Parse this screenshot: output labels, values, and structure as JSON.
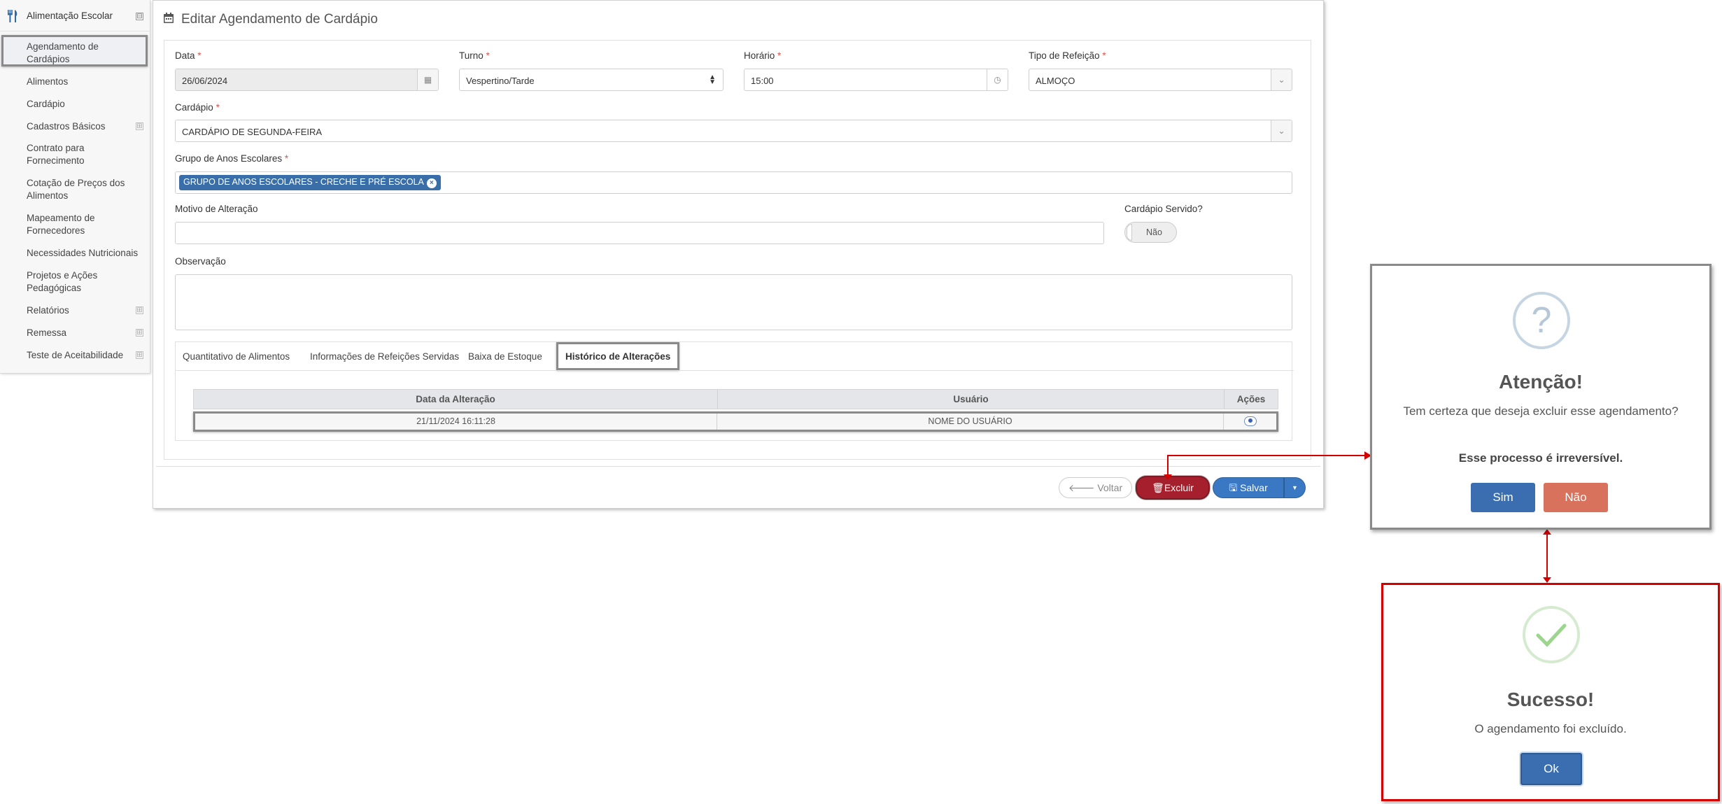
{
  "sidebar": {
    "title": "Alimentação Escolar",
    "toggle": "⊟",
    "items": [
      {
        "label": "Agendamento de Cardápios",
        "expandable": false
      },
      {
        "label": "Alimentos",
        "expandable": false
      },
      {
        "label": "Cardápio",
        "expandable": false
      },
      {
        "label": "Cadastros Básicos",
        "expandable": true
      },
      {
        "label": "Contrato para Fornecimento",
        "expandable": false
      },
      {
        "label": "Cotação de Preços dos Alimentos",
        "expandable": false
      },
      {
        "label": "Mapeamento de Fornecedores",
        "expandable": false
      },
      {
        "label": "Necessidades Nutricionais",
        "expandable": false
      },
      {
        "label": "Projetos e Ações Pedagógicas",
        "expandable": false
      },
      {
        "label": "Relatórios",
        "expandable": true
      },
      {
        "label": "Remessa",
        "expandable": true
      },
      {
        "label": "Teste de Aceitabilidade",
        "expandable": true
      }
    ],
    "expand_glyph": "⊞"
  },
  "page": {
    "title": "Editar Agendamento de Cardápio"
  },
  "form": {
    "data": {
      "label": "Data",
      "value": "26/06/2024"
    },
    "turno": {
      "label": "Turno",
      "value": "Vespertino/Tarde"
    },
    "horario": {
      "label": "Horário",
      "value": "15:00"
    },
    "tipo_refeicao": {
      "label": "Tipo de Refeição",
      "value": "ALMOÇO"
    },
    "cardapio": {
      "label": "Cardápio",
      "value": "CARDÁPIO DE SEGUNDA-FEIRA"
    },
    "grupo": {
      "label": "Grupo de Anos Escolares",
      "tag": "GRUPO DE ANOS ESCOLARES - CRECHE E PRÉ ESCOLA"
    },
    "motivo": {
      "label": "Motivo de Alteração",
      "value": ""
    },
    "servido": {
      "label": "Cardápio Servido?",
      "value": "Não"
    },
    "observacao": {
      "label": "Observação",
      "value": ""
    },
    "required_mark": "*"
  },
  "tabs": [
    {
      "label": "Quantitativo de Alimentos",
      "active": false
    },
    {
      "label": "Informações de Refeições Servidas",
      "active": false
    },
    {
      "label": "Baixa de Estoque",
      "active": false
    },
    {
      "label": "Histórico de Alterações",
      "active": true
    }
  ],
  "history_table": {
    "columns": [
      "Data da Alteração",
      "Usuário",
      "Ações"
    ],
    "rows": [
      {
        "date": "21/11/2024 16:11:28",
        "user": "NOME DO USUÁRIO"
      }
    ]
  },
  "actions": {
    "voltar": "Voltar",
    "excluir": "Excluir",
    "salvar": "Salvar"
  },
  "confirm_dialog": {
    "icon": "?",
    "title": "Atenção!",
    "message": "Tem certeza que deseja excluir esse agendamento?",
    "warning": "Esse processo é irreversível.",
    "yes": "Sim",
    "no": "Não"
  },
  "success_dialog": {
    "title": "Sucesso!",
    "message": "O agendamento foi excluído.",
    "ok": "Ok"
  },
  "colors": {
    "primary": "#3b78c3",
    "danger": "#a51f2c",
    "no_button": "#d9725c",
    "annotation_red": "#d40000",
    "tag_blue": "#3a6ea8"
  }
}
